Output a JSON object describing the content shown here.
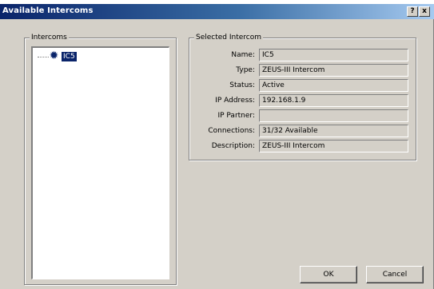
{
  "window": {
    "title": "Available Intercoms",
    "help_btn": "?",
    "close_btn": "x"
  },
  "intercoms_group": {
    "title": "Intercoms",
    "items": [
      {
        "label": "IC5",
        "icon": "gear-icon",
        "selected": true
      }
    ]
  },
  "selected_group": {
    "title": "Selected Intercom",
    "fields": [
      {
        "label": "Name:",
        "value": "IC5"
      },
      {
        "label": "Type:",
        "value": "ZEUS-III Intercom"
      },
      {
        "label": "Status:",
        "value": "Active"
      },
      {
        "label": "IP Address:",
        "value": "192.168.1.9"
      },
      {
        "label": "IP Partner:",
        "value": ""
      },
      {
        "label": "Connections:",
        "value": "31/32 Available"
      },
      {
        "label": "Description:",
        "value": "ZEUS-III Intercom"
      }
    ]
  },
  "buttons": {
    "ok": "OK",
    "cancel": "Cancel"
  },
  "colors": {
    "face": "#d4d0c8",
    "title_start": "#0a246a",
    "title_end": "#a6caf0",
    "selection": "#0a246a"
  }
}
